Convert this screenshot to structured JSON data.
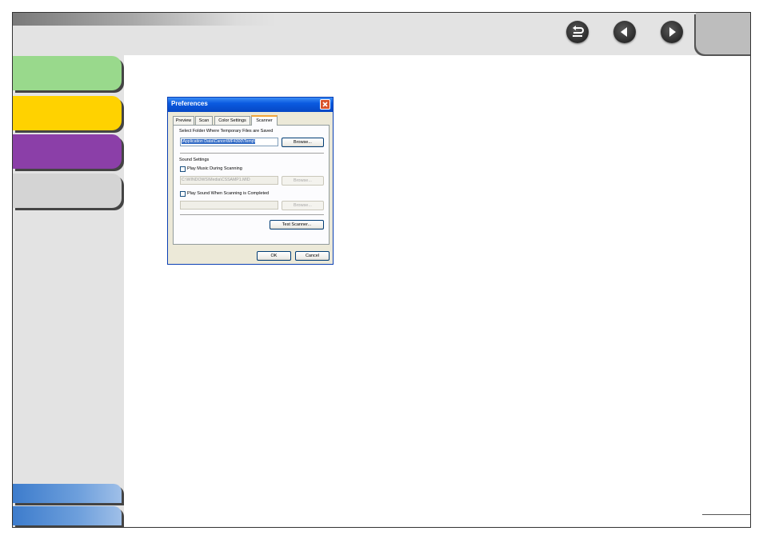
{
  "dialog": {
    "title": "Preferences",
    "tabs": [
      "Preview",
      "Scan",
      "Color Settings",
      "Scanner"
    ],
    "active_tab": "Scanner",
    "temp_folder_label": "Select Folder Where Temporary Files are Saved",
    "temp_folder_value": "\\Application Data\\Canon\\MF4300\\Temp\\",
    "browse_label": "Browse...",
    "sound_settings_label": "Sound Settings",
    "play_music_label": "Play Music During Scanning",
    "music_path_value": "C:\\WINDOWS\\Media\\CSSAMP1.MID",
    "play_sound_label": "Play Sound When Scanning is Completed",
    "test_scanner_label": "Test Scanner...",
    "ok_label": "OK",
    "cancel_label": "Cancel"
  },
  "colors": {
    "tab1": "#99d98c",
    "tab2": "#ffd200",
    "tab3": "#8b3fa8",
    "tab4": "#d4d4d4",
    "footer_tab": "#3d7ccc"
  },
  "icons": {
    "nav_back": "back-return-icon",
    "nav_prev": "left-arrow-icon",
    "nav_next": "right-arrow-icon"
  }
}
